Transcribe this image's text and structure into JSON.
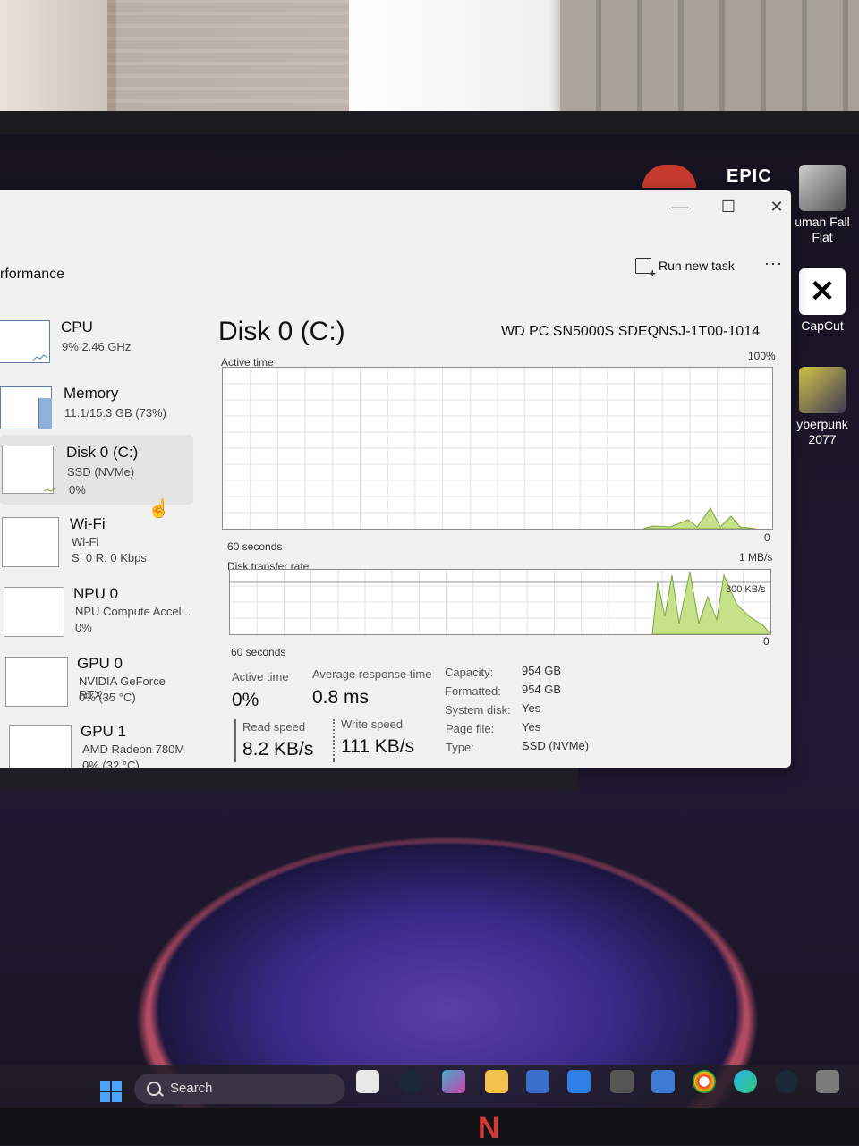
{
  "desktop": {
    "epic_label": "EPIC",
    "icons": [
      {
        "label": "uman Fall Flat",
        "icon": "human-fall-flat-icon"
      },
      {
        "label": "CapCut",
        "icon": "capcut-icon"
      },
      {
        "label": "yberpunk 2077",
        "icon": "cyberpunk-icon"
      }
    ]
  },
  "window": {
    "controls": {
      "minimize": "—",
      "maximize": "☐",
      "close": "✕"
    },
    "section_title": "rformance",
    "run_new_task": "Run new task",
    "more": "···"
  },
  "sidebar": [
    {
      "name": "CPU",
      "line1": "9% 2.46 GHz",
      "line2": ""
    },
    {
      "name": "Memory",
      "line1": "11.1/15.3 GB (73%)",
      "line2": ""
    },
    {
      "name": "Disk 0 (C:)",
      "line1": "SSD (NVMe)",
      "line2": "0%"
    },
    {
      "name": "Wi-Fi",
      "line1": "Wi-Fi",
      "line2": "S: 0 R: 0 Kbps"
    },
    {
      "name": "NPU 0",
      "line1": "NPU Compute Accel...",
      "line2": "0%"
    },
    {
      "name": "GPU 0",
      "line1": "NVIDIA GeForce RTX...",
      "line2": "0% (35 °C)"
    },
    {
      "name": "GPU 1",
      "line1": "AMD Radeon 780M ...",
      "line2": "0% (32 °C)"
    }
  ],
  "main": {
    "title": "Disk 0 (C:)",
    "device": "WD PC SN5000S SDEQNSJ-1T00-1014",
    "graph1": {
      "label": "Active time",
      "max": "100%",
      "min": "0",
      "time": "60 seconds"
    },
    "graph2": {
      "label": "Disk transfer rate",
      "max": "1 MB/s",
      "mid": "800 KB/s",
      "min": "0",
      "time": "60 seconds"
    },
    "stats": {
      "active_time_label": "Active time",
      "active_time_value": "0%",
      "avg_response_label": "Average response time",
      "avg_response_value": "0.8 ms",
      "read_label": "Read speed",
      "read_value": "8.2 KB/s",
      "write_label": "Write speed",
      "write_value": "111 KB/s"
    },
    "properties": [
      {
        "key": "Capacity:",
        "value": "954 GB"
      },
      {
        "key": "Formatted:",
        "value": "954 GB"
      },
      {
        "key": "System disk:",
        "value": "Yes"
      },
      {
        "key": "Page file:",
        "value": "Yes"
      },
      {
        "key": "Type:",
        "value": "SSD (NVMe)"
      }
    ]
  },
  "taskbar": {
    "search_placeholder": "Search"
  },
  "colors": {
    "graph_line": "#7aa83a",
    "graph_fill": "#c7e08a",
    "grid": "#e3e3e3",
    "window_bg": "#f1f1ef"
  }
}
